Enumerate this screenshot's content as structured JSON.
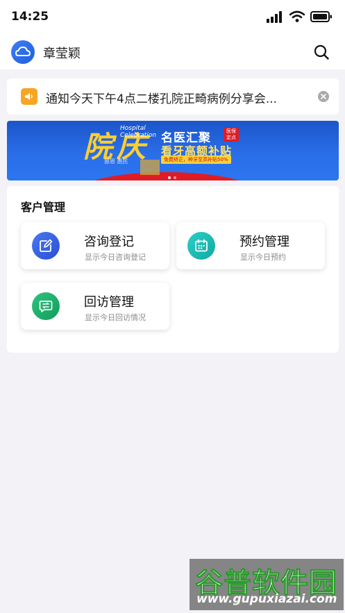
{
  "status_bar": {
    "time": "14:25"
  },
  "header": {
    "user_name": "章莹颖"
  },
  "notice": {
    "text": "通知今天下午4点二楼孔院正畸病例分享会..."
  },
  "banner": {
    "title_char": "院庆",
    "title_en_1": "Hospital",
    "title_en_2": "Celebration",
    "slogan": "感恩 惠民",
    "headline": "名医汇聚",
    "badge_1": "医保",
    "badge_2": "定点",
    "subheadline": "看牙高额补贴",
    "tagline": "免费矫正，种牙至高补贴50%",
    "slide_count": 2,
    "active_slide": 1
  },
  "customer_section": {
    "title": "客户管理",
    "tiles": [
      {
        "label": "咨询登记",
        "desc": "显示今日咨询登记",
        "icon": "edit-icon",
        "color": "#3562e6"
      },
      {
        "label": "预约管理",
        "desc": "显示今日预约",
        "icon": "calendar-icon",
        "color": "#17b7b0"
      },
      {
        "label": "回访管理",
        "desc": "显示今日回访情况",
        "icon": "chat-exchange-icon",
        "color": "#1faa6a"
      }
    ]
  },
  "watermark": {
    "title": "谷普软件园",
    "url": "www.gupuxiazai.com"
  }
}
